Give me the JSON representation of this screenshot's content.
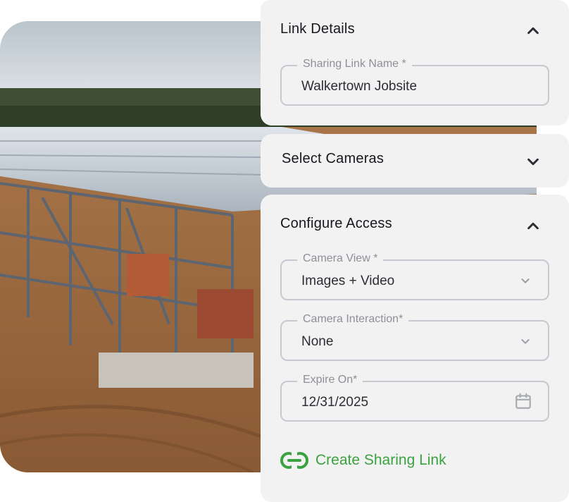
{
  "panels": {
    "link_details": {
      "title": "Link Details",
      "sharing_link_name": {
        "label": "Sharing Link Name *",
        "value": "Walkertown Jobsite"
      }
    },
    "select_cameras": {
      "title": "Select Cameras"
    },
    "configure_access": {
      "title": "Configure Access",
      "camera_view": {
        "label": "Camera View *",
        "value": "Images + Video"
      },
      "camera_interaction": {
        "label": "Camera Interaction*",
        "value": "None"
      },
      "expire_on": {
        "label": "Expire On*",
        "value": "12/31/2025"
      },
      "create_link_label": "Create Sharing Link"
    }
  },
  "icons": {
    "collapse": "chevron-up-icon",
    "expand": "chevron-down-icon",
    "calendar": "calendar-icon",
    "link": "link-icon"
  },
  "colors": {
    "accent_green": "#3aa33f",
    "panel_bg": "#f2f2f3",
    "field_border": "#c6c9cf",
    "label_gray": "#8d9097"
  }
}
